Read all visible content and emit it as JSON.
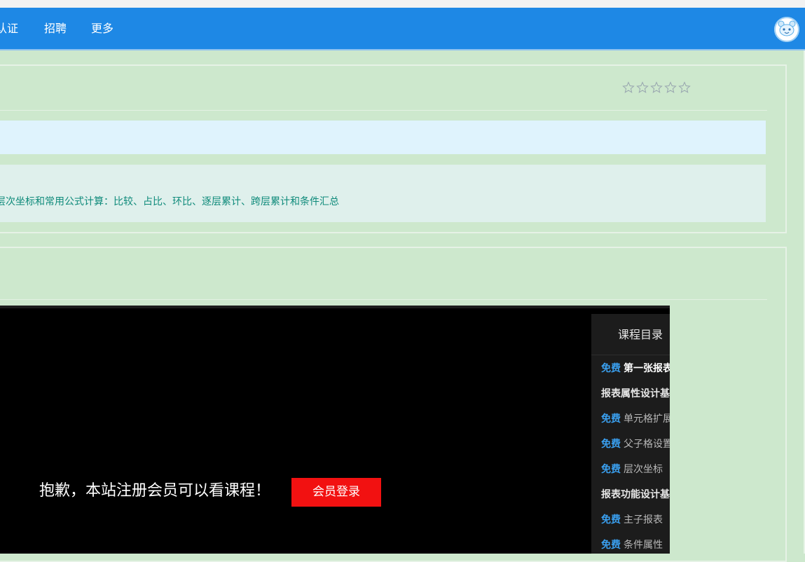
{
  "nav": {
    "items": [
      {
        "label": "认证"
      },
      {
        "label": "招聘"
      },
      {
        "label": "更多"
      }
    ]
  },
  "rating": {
    "stars": 5,
    "filled": 0
  },
  "course": {
    "description": "层次坐标和常用公式计算：比较、占比、环比、逐层累计、跨层累计和条件汇总"
  },
  "player": {
    "notice": "抱歉，本站注册会员可以看课程！",
    "login_label": "会员登录"
  },
  "catalog": {
    "title": "课程目录",
    "free_label": "免费",
    "entries": [
      {
        "type": "lesson",
        "free": true,
        "label": "第一张报表",
        "active": true
      },
      {
        "type": "section",
        "label": "报表属性设计基础"
      },
      {
        "type": "lesson",
        "free": true,
        "label": "单元格扩展"
      },
      {
        "type": "lesson",
        "free": true,
        "label": "父子格设置"
      },
      {
        "type": "lesson",
        "free": true,
        "label": "层次坐标"
      },
      {
        "type": "section",
        "label": "报表功能设计基础"
      },
      {
        "type": "lesson",
        "free": true,
        "label": "主子报表"
      },
      {
        "type": "lesson",
        "free": true,
        "label": "条件属性"
      }
    ]
  },
  "colors": {
    "navbar": "#1e88e5",
    "page_bg": "#cde8cd",
    "login_button": "#f21111",
    "free_tag": "#3aa0f0"
  }
}
